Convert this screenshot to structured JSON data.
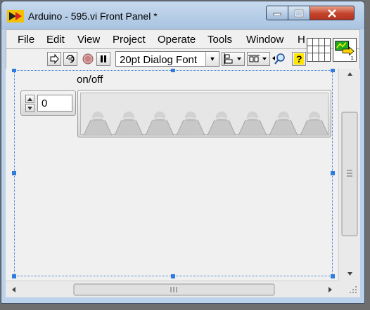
{
  "window": {
    "title": "Arduino - 595.vi Front Panel *"
  },
  "menu": {
    "items": [
      "File",
      "Edit",
      "View",
      "Project",
      "Operate",
      "Tools",
      "Window",
      "H"
    ]
  },
  "toolbar": {
    "font_select": "20pt Dialog Font"
  },
  "panel": {
    "array_label": "on/off",
    "index_value": "0",
    "leds_on": [
      false,
      false,
      false,
      false,
      false,
      false,
      false,
      false
    ]
  },
  "icons": {
    "run": "run-arrow-icon",
    "run_continuous": "run-continuously-icon",
    "abort": "abort-icon",
    "pause": "pause-icon",
    "align": "align-objects-icon",
    "distribute": "distribute-objects-icon",
    "search": "search-icon",
    "help": "context-help-icon"
  },
  "colors": {
    "selection": "#2f7bde",
    "close_button": "#c4432b"
  }
}
